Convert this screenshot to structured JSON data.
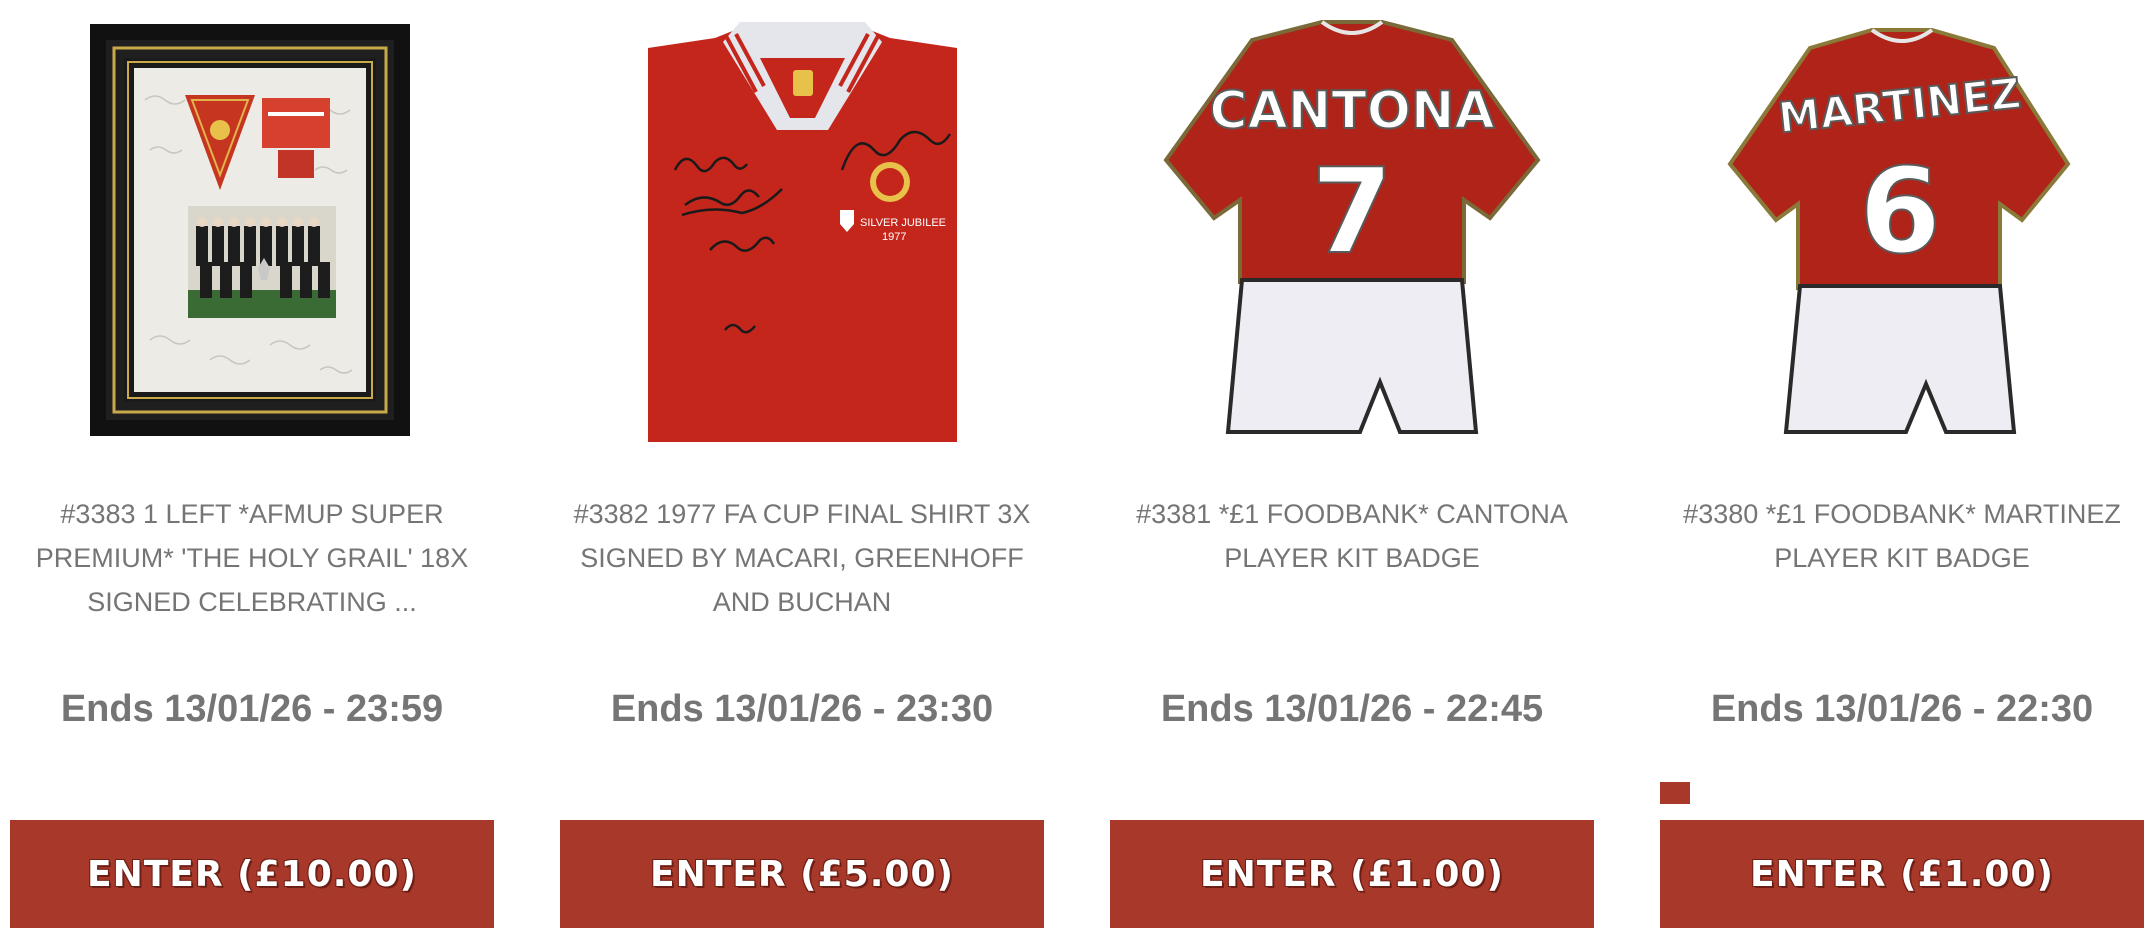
{
  "listings": [
    {
      "title": "#3383 1 LEFT *AFMUP SUPER PREMIUM* 'THE HOLY GRAIL' 18X SIGNED CELEBRATING ...",
      "ends": "Ends 13/01/26 - 23:59",
      "button": "ENTER (£10.00)",
      "image": "framed-memorabilia"
    },
    {
      "title": "#3382 1977 FA CUP FINAL SHIRT 3X SIGNED BY MACARI, GREENHOFF AND BUCHAN",
      "ends": "Ends 13/01/26 - 23:30",
      "button": "ENTER (£5.00)",
      "image": "signed-red-shirt",
      "shirt_text": [
        "SILVER JUBILEE",
        "1977"
      ]
    },
    {
      "title": "#3381 *£1 FOODBANK* CANTONA PLAYER KIT BADGE",
      "ends": "Ends 13/01/26 - 22:45",
      "button": "ENTER (£1.00)",
      "image": "kit-badge",
      "kit_name": "CANTONA",
      "kit_number": "7"
    },
    {
      "title": "#3380 *£1 FOODBANK* MARTINEZ PLAYER KIT BADGE",
      "ends": "Ends 13/01/26 - 22:30",
      "button": "ENTER (£1.00)",
      "image": "kit-badge",
      "kit_name": "MARTINEZ",
      "kit_number": "6"
    }
  ],
  "colors": {
    "brand_red": "#a8392a",
    "text_grey": "#757575",
    "shirt_red": "#c4261c"
  }
}
